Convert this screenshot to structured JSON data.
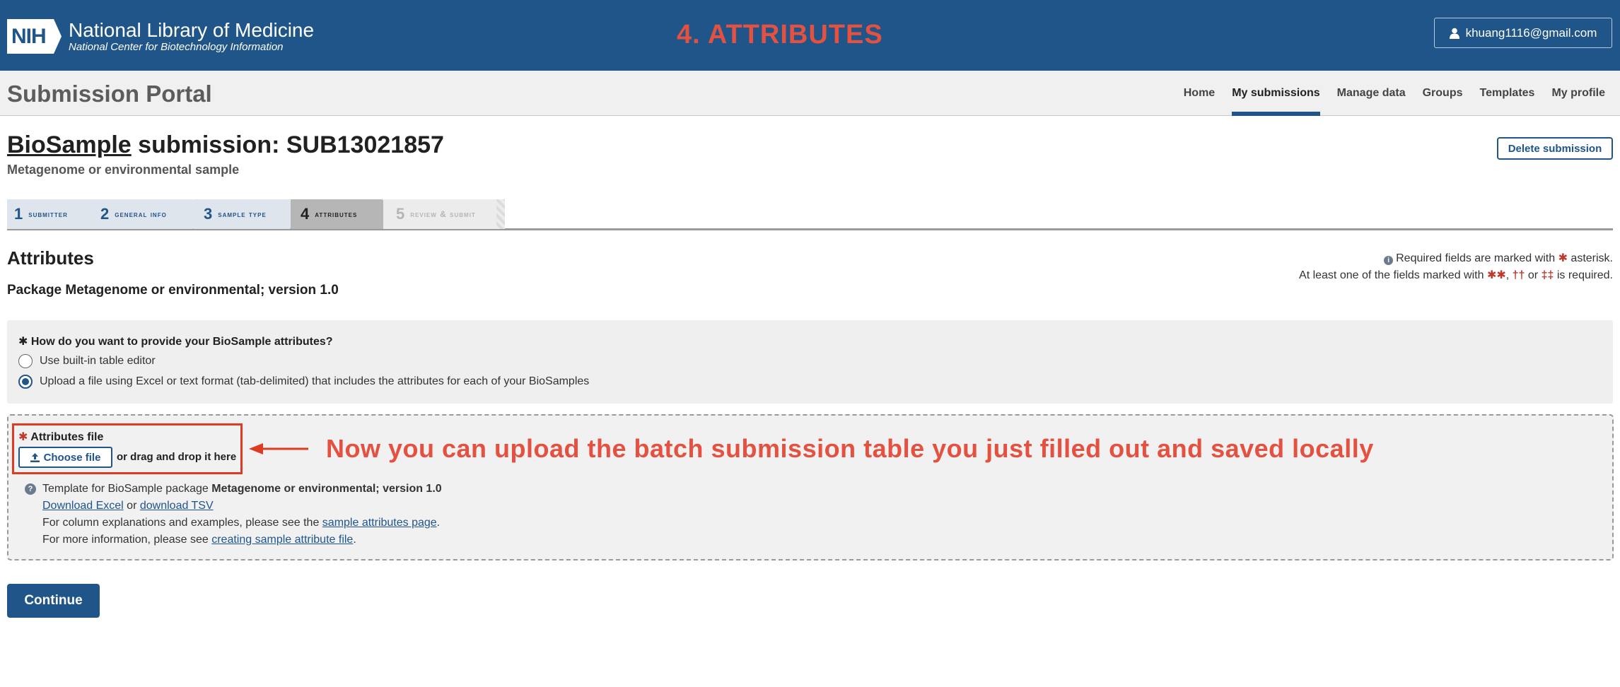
{
  "header": {
    "logo_text": "NIH",
    "org_title": "National Library of Medicine",
    "org_subtitle": "National Center for Biotechnology Information",
    "step_annotation": "4. ATTRIBUTES",
    "user_email": "khuang1116@gmail.com"
  },
  "portal": {
    "title": "Submission Portal",
    "nav": [
      "Home",
      "My submissions",
      "Manage data",
      "Groups",
      "Templates",
      "My profile"
    ],
    "active_nav": "My submissions"
  },
  "submission": {
    "title_link": "BioSample",
    "title_rest": " submission: SUB13021857",
    "type": "Metagenome or environmental sample",
    "delete_label": "Delete submission"
  },
  "steps": [
    {
      "num": "1",
      "label": "SUBMITTER",
      "state": "done"
    },
    {
      "num": "2",
      "label": "GENERAL INFO",
      "state": "done"
    },
    {
      "num": "3",
      "label": "SAMPLE TYPE",
      "state": "done"
    },
    {
      "num": "4",
      "label": "ATTRIBUTES",
      "state": "current"
    },
    {
      "num": "5",
      "label": "REVIEW & SUBMIT",
      "state": "future"
    }
  ],
  "attributes": {
    "heading": "Attributes",
    "package": "Package Metagenome or environmental; version 1.0",
    "req_note_1": "Required fields are marked with",
    "req_note_1_end": "asterisk.",
    "req_note_2_start": "At least one of the fields marked with",
    "req_note_2_sep1": ",",
    "req_note_2_sep2": "or",
    "req_note_2_end": "is required."
  },
  "provide": {
    "question": "How do you want to provide your BioSample attributes?",
    "options": [
      {
        "label": "Use built-in table editor",
        "checked": false
      },
      {
        "label": "Upload a file using Excel or text format (tab-delimited) that includes the attributes for each of your BioSamples",
        "checked": true
      }
    ]
  },
  "upload": {
    "label": "Attributes file",
    "choose_label": "Choose file",
    "drag_text": "or drag and drop it here",
    "annotation": "Now you can upload the batch submission table you just filled out and saved locally",
    "template_prefix": "Template for BioSample package ",
    "template_package": "Metagenome or environmental; version 1.0",
    "download_excel": "Download Excel",
    "or_text": " or ",
    "download_tsv": "download TSV",
    "columns_prefix": "For column explanations and examples, please see the ",
    "columns_link": "sample attributes page",
    "period": ".",
    "more_prefix": "For more information, please see ",
    "more_link": "creating sample attribute file"
  },
  "continue_label": "Continue",
  "colors": {
    "brand_blue": "#20558a",
    "annotation_red": "#e55140",
    "highlight_red": "#dd3b23"
  }
}
